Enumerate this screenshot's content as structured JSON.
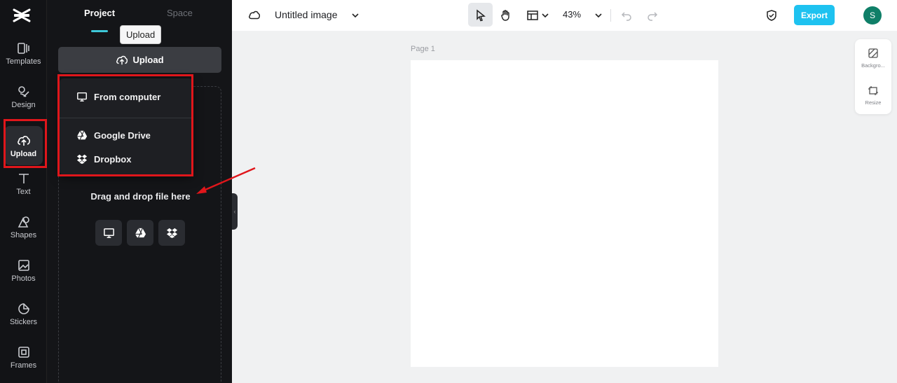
{
  "rail": {
    "items": [
      {
        "label": "Templates"
      },
      {
        "label": "Design"
      },
      {
        "label": "Upload"
      },
      {
        "label": "Text"
      },
      {
        "label": "Shapes"
      },
      {
        "label": "Photos"
      },
      {
        "label": "Stickers"
      },
      {
        "label": "Frames"
      }
    ],
    "active": "Upload"
  },
  "panel": {
    "tabs": [
      {
        "label": "Project"
      },
      {
        "label": "Space"
      }
    ],
    "active_tab": "Project",
    "tooltip": "Upload",
    "upload_button": "Upload",
    "menu": {
      "items": [
        {
          "label": "From computer",
          "icon": "monitor-icon"
        },
        {
          "label": "Google Drive",
          "icon": "google-drive-icon"
        },
        {
          "label": "Dropbox",
          "icon": "dropbox-icon"
        }
      ]
    },
    "drag_text": "Drag and drop file here"
  },
  "topbar": {
    "title": "Untitled image",
    "zoom": "43%",
    "export_label": "Export",
    "avatar_initial": "S"
  },
  "canvas": {
    "page_label": "Page 1"
  },
  "rightbar": {
    "items": [
      {
        "label": "Backgro..."
      },
      {
        "label": "Resize"
      }
    ]
  },
  "colors": {
    "accent": "#1ec2f0",
    "highlight": "#e0161b",
    "avatar": "#0f7f68"
  }
}
